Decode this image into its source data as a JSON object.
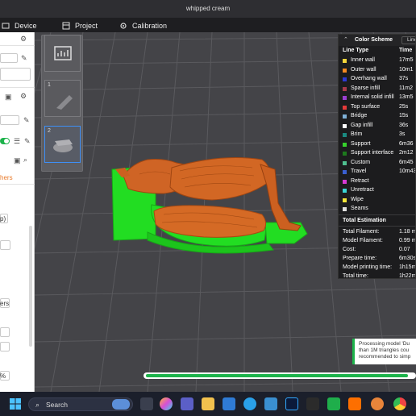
{
  "window": {
    "title": "whipped cream"
  },
  "nav": {
    "items": [
      {
        "label": "Device",
        "icon": "device-icon"
      },
      {
        "label": "Project",
        "icon": "project-icon"
      },
      {
        "label": "Calibration",
        "icon": "calibration-icon"
      }
    ]
  },
  "left_panel": {
    "partial_text_1": "hers",
    "partial_text_2": "p)",
    "partial_text_3": "ers",
    "partial_text_4": "%"
  },
  "plates": [
    {
      "num": "1"
    },
    {
      "num": "2"
    }
  ],
  "legend": {
    "title": "Color Scheme",
    "selector": "Line",
    "col_type": "Line Type",
    "col_time": "Time",
    "rows": [
      {
        "name": "Inner wall",
        "time": "17m5",
        "color": "#f5d63a"
      },
      {
        "name": "Outer wall",
        "time": "10m1",
        "color": "#f58a22"
      },
      {
        "name": "Overhang wall",
        "time": "37s",
        "color": "#2d3bd6"
      },
      {
        "name": "Sparse infill",
        "time": "11m2",
        "color": "#a83a4a"
      },
      {
        "name": "Internal solid infill",
        "time": "13m5",
        "color": "#9a3fd1"
      },
      {
        "name": "Top surface",
        "time": "25s",
        "color": "#e63a3a"
      },
      {
        "name": "Bridge",
        "time": "15s",
        "color": "#7fb0d6"
      },
      {
        "name": "Gap infill",
        "time": "36s",
        "color": "#ffffff"
      },
      {
        "name": "Brim",
        "time": "3s",
        "color": "#1a8a80"
      },
      {
        "name": "Support",
        "time": "6m36",
        "color": "#36d12c"
      },
      {
        "name": "Support interface",
        "time": "2m12",
        "color": "#1d7a1d"
      },
      {
        "name": "Custom",
        "time": "6m45",
        "color": "#4fbf8f"
      },
      {
        "name": "Travel",
        "time": "10m43",
        "color": "#3a5fd0"
      },
      {
        "name": "Retract",
        "time": "",
        "color": "#d63ad6"
      },
      {
        "name": "Unretract",
        "time": "",
        "color": "#3ad6d6"
      },
      {
        "name": "Wipe",
        "time": "",
        "color": "#f5e63a"
      },
      {
        "name": "Seams",
        "time": "",
        "color": "#e0e0e0"
      }
    ],
    "estimation_title": "Total Estimation",
    "stats": [
      {
        "name": "Total Filament:",
        "value": "1.18 m"
      },
      {
        "name": "Model Filament:",
        "value": "0.99 m"
      },
      {
        "name": "Cost:",
        "value": "0.07"
      },
      {
        "name": "Prepare time:",
        "value": "6m30s"
      },
      {
        "name": "Model printing time:",
        "value": "1h15m"
      },
      {
        "name": "Total time:",
        "value": "1h22m"
      }
    ]
  },
  "notice": {
    "line1": "Processing model 'Du",
    "line2": "than 1M triangles cou",
    "line3": "recommended to simp"
  },
  "progress": {
    "fraction": 0.98
  },
  "taskbar": {
    "search_placeholder": "Search"
  }
}
